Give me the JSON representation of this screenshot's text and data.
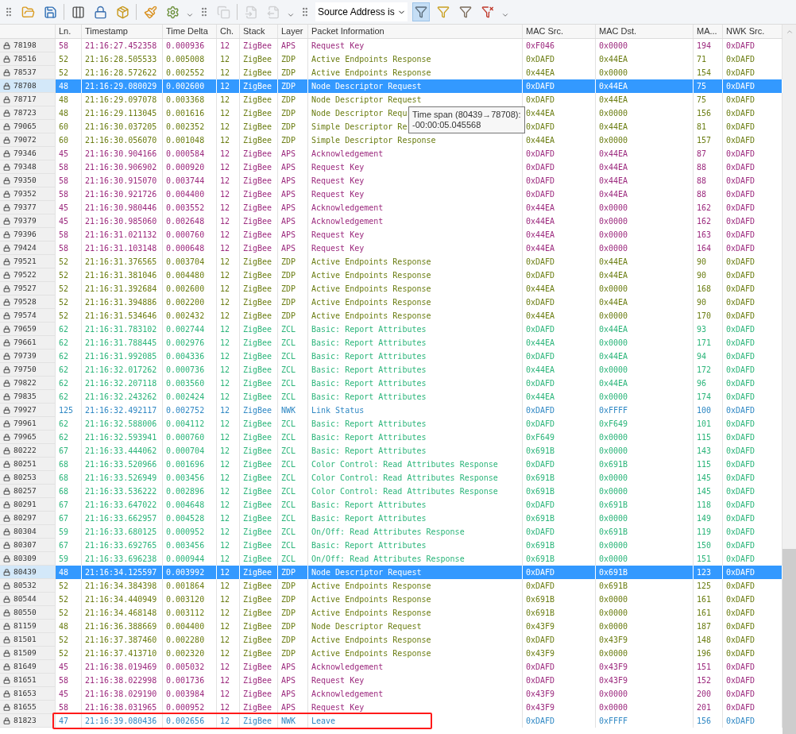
{
  "toolbar": {
    "groups": [
      [
        {
          "kind": "open",
          "disabled": false
        },
        {
          "kind": "save",
          "disabled": false
        },
        {
          "kind": "separator"
        },
        {
          "kind": "columns",
          "disabled": false
        },
        {
          "kind": "lock-list",
          "disabled": false
        },
        {
          "kind": "export",
          "disabled": false
        },
        {
          "kind": "separator"
        },
        {
          "kind": "clean",
          "disabled": false
        },
        {
          "kind": "settings",
          "disabled": false
        }
      ],
      [
        {
          "kind": "copy",
          "disabled": true
        },
        {
          "kind": "separator"
        },
        {
          "kind": "back",
          "disabled": true
        },
        {
          "kind": "forward",
          "disabled": true
        }
      ]
    ],
    "filter": {
      "value": "Source Address is"
    },
    "filter_buttons": [
      {
        "kind": "apply",
        "selected": true
      },
      {
        "kind": "new",
        "selected": false
      },
      {
        "kind": "edit",
        "selected": false
      },
      {
        "kind": "clear",
        "selected": false
      }
    ]
  },
  "table": {
    "columns": [
      "Ln.",
      "Timestamp",
      "Time Delta",
      "Ch.",
      "Stack",
      "Layer",
      "Packet Information",
      "MAC Src.",
      "MAC Dst.",
      "MA...",
      "NWK Src."
    ],
    "rows": [
      {
        "no": "78198",
        "ln": "58",
        "timestamp": "21:16:27.452358",
        "delta": "0.000936",
        "ch": "12",
        "stack": "ZigBee",
        "layer": "APS",
        "info": "Request Key",
        "mac_src": "0xF046",
        "mac_dst": "0x0000",
        "ma": "194",
        "nwk_src": "0xDAFD",
        "color": "#9c2a7e",
        "selected": false,
        "outlined": false
      },
      {
        "no": "78516",
        "ln": "52",
        "timestamp": "21:16:28.505533",
        "delta": "0.005008",
        "ch": "12",
        "stack": "ZigBee",
        "layer": "ZDP",
        "info": "Active Endpoints Response",
        "mac_src": "0xDAFD",
        "mac_dst": "0x44EA",
        "ma": "71",
        "nwk_src": "0xDAFD",
        "color": "#6b7d12",
        "selected": false,
        "outlined": false
      },
      {
        "no": "78537",
        "ln": "52",
        "timestamp": "21:16:28.572622",
        "delta": "0.002552",
        "ch": "12",
        "stack": "ZigBee",
        "layer": "ZDP",
        "info": "Active Endpoints Response",
        "mac_src": "0x44EA",
        "mac_dst": "0x0000",
        "ma": "154",
        "nwk_src": "0xDAFD",
        "color": "#6b7d12",
        "selected": false,
        "outlined": false
      },
      {
        "no": "78708",
        "ln": "48",
        "timestamp": "21:16:29.080029",
        "delta": "0.002600",
        "ch": "12",
        "stack": "ZigBee",
        "layer": "ZDP",
        "info": "Node Descriptor Request",
        "mac_src": "0xDAFD",
        "mac_dst": "0x44EA",
        "ma": "75",
        "nwk_src": "0xDAFD",
        "selected": true,
        "outlined": false
      },
      {
        "no": "78717",
        "ln": "48",
        "timestamp": "21:16:29.097078",
        "delta": "0.003368",
        "ch": "12",
        "stack": "ZigBee",
        "layer": "ZDP",
        "info": "Node Descriptor Request",
        "mac_src": "0xDAFD",
        "mac_dst": "0x44EA",
        "ma": "75",
        "nwk_src": "0xDAFD",
        "color": "#6b7d12",
        "selected": false,
        "outlined": false
      },
      {
        "no": "78723",
        "ln": "48",
        "timestamp": "21:16:29.113045",
        "delta": "0.001616",
        "ch": "12",
        "stack": "ZigBee",
        "layer": "ZDP",
        "info": "Node Descriptor Requ",
        "mac_src": "0x44EA",
        "mac_dst": "0x0000",
        "ma": "156",
        "nwk_src": "0xDAFD",
        "color": "#6b7d12",
        "selected": false,
        "outlined": false
      },
      {
        "no": "79065",
        "ln": "60",
        "timestamp": "21:16:30.037205",
        "delta": "0.002352",
        "ch": "12",
        "stack": "ZigBee",
        "layer": "ZDP",
        "info": "Simple Descriptor Re",
        "mac_src": "0xDAFD",
        "mac_dst": "0x44EA",
        "ma": "81",
        "nwk_src": "0xDAFD",
        "color": "#6b7d12",
        "selected": false,
        "outlined": false
      },
      {
        "no": "79072",
        "ln": "60",
        "timestamp": "21:16:30.056070",
        "delta": "0.001048",
        "ch": "12",
        "stack": "ZigBee",
        "layer": "ZDP",
        "info": "Simple Descriptor Response",
        "mac_src": "0x44EA",
        "mac_dst": "0x0000",
        "ma": "157",
        "nwk_src": "0xDAFD",
        "color": "#6b7d12",
        "selected": false,
        "outlined": false
      },
      {
        "no": "79346",
        "ln": "45",
        "timestamp": "21:16:30.904166",
        "delta": "0.000584",
        "ch": "12",
        "stack": "ZigBee",
        "layer": "APS",
        "info": "Acknowledgement",
        "mac_src": "0xDAFD",
        "mac_dst": "0x44EA",
        "ma": "87",
        "nwk_src": "0xDAFD",
        "color": "#9c2a7e",
        "selected": false,
        "outlined": false
      },
      {
        "no": "79348",
        "ln": "58",
        "timestamp": "21:16:30.906902",
        "delta": "0.000920",
        "ch": "12",
        "stack": "ZigBee",
        "layer": "APS",
        "info": "Request Key",
        "mac_src": "0xDAFD",
        "mac_dst": "0x44EA",
        "ma": "88",
        "nwk_src": "0xDAFD",
        "color": "#9c2a7e",
        "selected": false,
        "outlined": false
      },
      {
        "no": "79350",
        "ln": "58",
        "timestamp": "21:16:30.915070",
        "delta": "0.003744",
        "ch": "12",
        "stack": "ZigBee",
        "layer": "APS",
        "info": "Request Key",
        "mac_src": "0xDAFD",
        "mac_dst": "0x44EA",
        "ma": "88",
        "nwk_src": "0xDAFD",
        "color": "#9c2a7e",
        "selected": false,
        "outlined": false
      },
      {
        "no": "79352",
        "ln": "58",
        "timestamp": "21:16:30.921726",
        "delta": "0.004400",
        "ch": "12",
        "stack": "ZigBee",
        "layer": "APS",
        "info": "Request Key",
        "mac_src": "0xDAFD",
        "mac_dst": "0x44EA",
        "ma": "88",
        "nwk_src": "0xDAFD",
        "color": "#9c2a7e",
        "selected": false,
        "outlined": false
      },
      {
        "no": "79377",
        "ln": "45",
        "timestamp": "21:16:30.980446",
        "delta": "0.003552",
        "ch": "12",
        "stack": "ZigBee",
        "layer": "APS",
        "info": "Acknowledgement",
        "mac_src": "0x44EA",
        "mac_dst": "0x0000",
        "ma": "162",
        "nwk_src": "0xDAFD",
        "color": "#9c2a7e",
        "selected": false,
        "outlined": false
      },
      {
        "no": "79379",
        "ln": "45",
        "timestamp": "21:16:30.985060",
        "delta": "0.002648",
        "ch": "12",
        "stack": "ZigBee",
        "layer": "APS",
        "info": "Acknowledgement",
        "mac_src": "0x44EA",
        "mac_dst": "0x0000",
        "ma": "162",
        "nwk_src": "0xDAFD",
        "color": "#9c2a7e",
        "selected": false,
        "outlined": false
      },
      {
        "no": "79396",
        "ln": "58",
        "timestamp": "21:16:31.021132",
        "delta": "0.000760",
        "ch": "12",
        "stack": "ZigBee",
        "layer": "APS",
        "info": "Request Key",
        "mac_src": "0x44EA",
        "mac_dst": "0x0000",
        "ma": "163",
        "nwk_src": "0xDAFD",
        "color": "#9c2a7e",
        "selected": false,
        "outlined": false
      },
      {
        "no": "79424",
        "ln": "58",
        "timestamp": "21:16:31.103148",
        "delta": "0.000648",
        "ch": "12",
        "stack": "ZigBee",
        "layer": "APS",
        "info": "Request Key",
        "mac_src": "0x44EA",
        "mac_dst": "0x0000",
        "ma": "164",
        "nwk_src": "0xDAFD",
        "color": "#9c2a7e",
        "selected": false,
        "outlined": false
      },
      {
        "no": "79521",
        "ln": "52",
        "timestamp": "21:16:31.376565",
        "delta": "0.003704",
        "ch": "12",
        "stack": "ZigBee",
        "layer": "ZDP",
        "info": "Active Endpoints Response",
        "mac_src": "0xDAFD",
        "mac_dst": "0x44EA",
        "ma": "90",
        "nwk_src": "0xDAFD",
        "color": "#6b7d12",
        "selected": false,
        "outlined": false
      },
      {
        "no": "79522",
        "ln": "52",
        "timestamp": "21:16:31.381046",
        "delta": "0.004480",
        "ch": "12",
        "stack": "ZigBee",
        "layer": "ZDP",
        "info": "Active Endpoints Response",
        "mac_src": "0xDAFD",
        "mac_dst": "0x44EA",
        "ma": "90",
        "nwk_src": "0xDAFD",
        "color": "#6b7d12",
        "selected": false,
        "outlined": false
      },
      {
        "no": "79527",
        "ln": "52",
        "timestamp": "21:16:31.392684",
        "delta": "0.002600",
        "ch": "12",
        "stack": "ZigBee",
        "layer": "ZDP",
        "info": "Active Endpoints Response",
        "mac_src": "0x44EA",
        "mac_dst": "0x0000",
        "ma": "168",
        "nwk_src": "0xDAFD",
        "color": "#6b7d12",
        "selected": false,
        "outlined": false
      },
      {
        "no": "79528",
        "ln": "52",
        "timestamp": "21:16:31.394886",
        "delta": "0.002200",
        "ch": "12",
        "stack": "ZigBee",
        "layer": "ZDP",
        "info": "Active Endpoints Response",
        "mac_src": "0xDAFD",
        "mac_dst": "0x44EA",
        "ma": "90",
        "nwk_src": "0xDAFD",
        "color": "#6b7d12",
        "selected": false,
        "outlined": false
      },
      {
        "no": "79574",
        "ln": "52",
        "timestamp": "21:16:31.534646",
        "delta": "0.002432",
        "ch": "12",
        "stack": "ZigBee",
        "layer": "ZDP",
        "info": "Active Endpoints Response",
        "mac_src": "0x44EA",
        "mac_dst": "0x0000",
        "ma": "170",
        "nwk_src": "0xDAFD",
        "color": "#6b7d12",
        "selected": false,
        "outlined": false
      },
      {
        "no": "79659",
        "ln": "62",
        "timestamp": "21:16:31.783102",
        "delta": "0.002744",
        "ch": "12",
        "stack": "ZigBee",
        "layer": "ZCL",
        "info": "Basic: Report Attributes",
        "mac_src": "0xDAFD",
        "mac_dst": "0x44EA",
        "ma": "93",
        "nwk_src": "0xDAFD",
        "color": "#2bb57a",
        "selected": false,
        "outlined": false
      },
      {
        "no": "79661",
        "ln": "62",
        "timestamp": "21:16:31.788445",
        "delta": "0.002976",
        "ch": "12",
        "stack": "ZigBee",
        "layer": "ZCL",
        "info": "Basic: Report Attributes",
        "mac_src": "0x44EA",
        "mac_dst": "0x0000",
        "ma": "171",
        "nwk_src": "0xDAFD",
        "color": "#2bb57a",
        "selected": false,
        "outlined": false
      },
      {
        "no": "79739",
        "ln": "62",
        "timestamp": "21:16:31.992085",
        "delta": "0.004336",
        "ch": "12",
        "stack": "ZigBee",
        "layer": "ZCL",
        "info": "Basic: Report Attributes",
        "mac_src": "0xDAFD",
        "mac_dst": "0x44EA",
        "ma": "94",
        "nwk_src": "0xDAFD",
        "color": "#2bb57a",
        "selected": false,
        "outlined": false
      },
      {
        "no": "79750",
        "ln": "62",
        "timestamp": "21:16:32.017262",
        "delta": "0.000736",
        "ch": "12",
        "stack": "ZigBee",
        "layer": "ZCL",
        "info": "Basic: Report Attributes",
        "mac_src": "0x44EA",
        "mac_dst": "0x0000",
        "ma": "172",
        "nwk_src": "0xDAFD",
        "color": "#2bb57a",
        "selected": false,
        "outlined": false
      },
      {
        "no": "79822",
        "ln": "62",
        "timestamp": "21:16:32.207118",
        "delta": "0.003560",
        "ch": "12",
        "stack": "ZigBee",
        "layer": "ZCL",
        "info": "Basic: Report Attributes",
        "mac_src": "0xDAFD",
        "mac_dst": "0x44EA",
        "ma": "96",
        "nwk_src": "0xDAFD",
        "color": "#2bb57a",
        "selected": false,
        "outlined": false
      },
      {
        "no": "79835",
        "ln": "62",
        "timestamp": "21:16:32.243262",
        "delta": "0.002424",
        "ch": "12",
        "stack": "ZigBee",
        "layer": "ZCL",
        "info": "Basic: Report Attributes",
        "mac_src": "0x44EA",
        "mac_dst": "0x0000",
        "ma": "174",
        "nwk_src": "0xDAFD",
        "color": "#2bb57a",
        "selected": false,
        "outlined": false
      },
      {
        "no": "79927",
        "ln": "125",
        "timestamp": "21:16:32.492117",
        "delta": "0.002752",
        "ch": "12",
        "stack": "ZigBee",
        "layer": "NWK",
        "info": "Link Status",
        "mac_src": "0xDAFD",
        "mac_dst": "0xFFFF",
        "ma": "100",
        "nwk_src": "0xDAFD",
        "color": "#2f88c4",
        "selected": false,
        "outlined": false
      },
      {
        "no": "79961",
        "ln": "62",
        "timestamp": "21:16:32.588006",
        "delta": "0.004112",
        "ch": "12",
        "stack": "ZigBee",
        "layer": "ZCL",
        "info": "Basic: Report Attributes",
        "mac_src": "0xDAFD",
        "mac_dst": "0xF649",
        "ma": "101",
        "nwk_src": "0xDAFD",
        "color": "#2bb57a",
        "selected": false,
        "outlined": false
      },
      {
        "no": "79965",
        "ln": "62",
        "timestamp": "21:16:32.593941",
        "delta": "0.000760",
        "ch": "12",
        "stack": "ZigBee",
        "layer": "ZCL",
        "info": "Basic: Report Attributes",
        "mac_src": "0xF649",
        "mac_dst": "0x0000",
        "ma": "115",
        "nwk_src": "0xDAFD",
        "color": "#2bb57a",
        "selected": false,
        "outlined": false
      },
      {
        "no": "80222",
        "ln": "67",
        "timestamp": "21:16:33.444062",
        "delta": "0.000704",
        "ch": "12",
        "stack": "ZigBee",
        "layer": "ZCL",
        "info": "Basic: Report Attributes",
        "mac_src": "0x691B",
        "mac_dst": "0x0000",
        "ma": "143",
        "nwk_src": "0xDAFD",
        "color": "#2bb57a",
        "selected": false,
        "outlined": false
      },
      {
        "no": "80251",
        "ln": "68",
        "timestamp": "21:16:33.520966",
        "delta": "0.001696",
        "ch": "12",
        "stack": "ZigBee",
        "layer": "ZCL",
        "info": "Color Control: Read Attributes Response",
        "mac_src": "0xDAFD",
        "mac_dst": "0x691B",
        "ma": "115",
        "nwk_src": "0xDAFD",
        "color": "#2bb57a",
        "selected": false,
        "outlined": false
      },
      {
        "no": "80253",
        "ln": "68",
        "timestamp": "21:16:33.526949",
        "delta": "0.003456",
        "ch": "12",
        "stack": "ZigBee",
        "layer": "ZCL",
        "info": "Color Control: Read Attributes Response",
        "mac_src": "0x691B",
        "mac_dst": "0x0000",
        "ma": "145",
        "nwk_src": "0xDAFD",
        "color": "#2bb57a",
        "selected": false,
        "outlined": false
      },
      {
        "no": "80257",
        "ln": "68",
        "timestamp": "21:16:33.536222",
        "delta": "0.002896",
        "ch": "12",
        "stack": "ZigBee",
        "layer": "ZCL",
        "info": "Color Control: Read Attributes Response",
        "mac_src": "0x691B",
        "mac_dst": "0x0000",
        "ma": "145",
        "nwk_src": "0xDAFD",
        "color": "#2bb57a",
        "selected": false,
        "outlined": false
      },
      {
        "no": "80291",
        "ln": "67",
        "timestamp": "21:16:33.647022",
        "delta": "0.004648",
        "ch": "12",
        "stack": "ZigBee",
        "layer": "ZCL",
        "info": "Basic: Report Attributes",
        "mac_src": "0xDAFD",
        "mac_dst": "0x691B",
        "ma": "118",
        "nwk_src": "0xDAFD",
        "color": "#2bb57a",
        "selected": false,
        "outlined": false
      },
      {
        "no": "80297",
        "ln": "67",
        "timestamp": "21:16:33.662957",
        "delta": "0.004528",
        "ch": "12",
        "stack": "ZigBee",
        "layer": "ZCL",
        "info": "Basic: Report Attributes",
        "mac_src": "0x691B",
        "mac_dst": "0x0000",
        "ma": "149",
        "nwk_src": "0xDAFD",
        "color": "#2bb57a",
        "selected": false,
        "outlined": false
      },
      {
        "no": "80304",
        "ln": "59",
        "timestamp": "21:16:33.680125",
        "delta": "0.000952",
        "ch": "12",
        "stack": "ZigBee",
        "layer": "ZCL",
        "info": "On/Off: Read Attributes Response",
        "mac_src": "0xDAFD",
        "mac_dst": "0x691B",
        "ma": "119",
        "nwk_src": "0xDAFD",
        "color": "#2bb57a",
        "selected": false,
        "outlined": false
      },
      {
        "no": "80307",
        "ln": "67",
        "timestamp": "21:16:33.692765",
        "delta": "0.003456",
        "ch": "12",
        "stack": "ZigBee",
        "layer": "ZCL",
        "info": "Basic: Report Attributes",
        "mac_src": "0x691B",
        "mac_dst": "0x0000",
        "ma": "150",
        "nwk_src": "0xDAFD",
        "color": "#2bb57a",
        "selected": false,
        "outlined": false
      },
      {
        "no": "80309",
        "ln": "59",
        "timestamp": "21:16:33.696238",
        "delta": "0.000944",
        "ch": "12",
        "stack": "ZigBee",
        "layer": "ZCL",
        "info": "On/Off: Read Attributes Response",
        "mac_src": "0x691B",
        "mac_dst": "0x0000",
        "ma": "151",
        "nwk_src": "0xDAFD",
        "color": "#2bb57a",
        "selected": false,
        "outlined": false
      },
      {
        "no": "80439",
        "ln": "48",
        "timestamp": "21:16:34.125597",
        "delta": "0.003992",
        "ch": "12",
        "stack": "ZigBee",
        "layer": "ZDP",
        "info": "Node Descriptor Request",
        "mac_src": "0xDAFD",
        "mac_dst": "0x691B",
        "ma": "123",
        "nwk_src": "0xDAFD",
        "selected": true,
        "outlined": false
      },
      {
        "no": "80532",
        "ln": "52",
        "timestamp": "21:16:34.384398",
        "delta": "0.001864",
        "ch": "12",
        "stack": "ZigBee",
        "layer": "ZDP",
        "info": "Active Endpoints Response",
        "mac_src": "0xDAFD",
        "mac_dst": "0x691B",
        "ma": "125",
        "nwk_src": "0xDAFD",
        "color": "#6b7d12",
        "selected": false,
        "outlined": false
      },
      {
        "no": "80544",
        "ln": "52",
        "timestamp": "21:16:34.440949",
        "delta": "0.003120",
        "ch": "12",
        "stack": "ZigBee",
        "layer": "ZDP",
        "info": "Active Endpoints Response",
        "mac_src": "0x691B",
        "mac_dst": "0x0000",
        "ma": "161",
        "nwk_src": "0xDAFD",
        "color": "#6b7d12",
        "selected": false,
        "outlined": false
      },
      {
        "no": "80550",
        "ln": "52",
        "timestamp": "21:16:34.468148",
        "delta": "0.003112",
        "ch": "12",
        "stack": "ZigBee",
        "layer": "ZDP",
        "info": "Active Endpoints Response",
        "mac_src": "0x691B",
        "mac_dst": "0x0000",
        "ma": "161",
        "nwk_src": "0xDAFD",
        "color": "#6b7d12",
        "selected": false,
        "outlined": false
      },
      {
        "no": "81159",
        "ln": "48",
        "timestamp": "21:16:36.388669",
        "delta": "0.004400",
        "ch": "12",
        "stack": "ZigBee",
        "layer": "ZDP",
        "info": "Node Descriptor Request",
        "mac_src": "0x43F9",
        "mac_dst": "0x0000",
        "ma": "187",
        "nwk_src": "0xDAFD",
        "color": "#6b7d12",
        "selected": false,
        "outlined": false
      },
      {
        "no": "81501",
        "ln": "52",
        "timestamp": "21:16:37.387460",
        "delta": "0.002280",
        "ch": "12",
        "stack": "ZigBee",
        "layer": "ZDP",
        "info": "Active Endpoints Response",
        "mac_src": "0xDAFD",
        "mac_dst": "0x43F9",
        "ma": "148",
        "nwk_src": "0xDAFD",
        "color": "#6b7d12",
        "selected": false,
        "outlined": false
      },
      {
        "no": "81509",
        "ln": "52",
        "timestamp": "21:16:37.413710",
        "delta": "0.002320",
        "ch": "12",
        "stack": "ZigBee",
        "layer": "ZDP",
        "info": "Active Endpoints Response",
        "mac_src": "0x43F9",
        "mac_dst": "0x0000",
        "ma": "196",
        "nwk_src": "0xDAFD",
        "color": "#6b7d12",
        "selected": false,
        "outlined": false
      },
      {
        "no": "81649",
        "ln": "45",
        "timestamp": "21:16:38.019469",
        "delta": "0.005032",
        "ch": "12",
        "stack": "ZigBee",
        "layer": "APS",
        "info": "Acknowledgement",
        "mac_src": "0xDAFD",
        "mac_dst": "0x43F9",
        "ma": "151",
        "nwk_src": "0xDAFD",
        "color": "#9c2a7e",
        "selected": false,
        "outlined": false
      },
      {
        "no": "81651",
        "ln": "58",
        "timestamp": "21:16:38.022998",
        "delta": "0.001736",
        "ch": "12",
        "stack": "ZigBee",
        "layer": "APS",
        "info": "Request Key",
        "mac_src": "0xDAFD",
        "mac_dst": "0x43F9",
        "ma": "152",
        "nwk_src": "0xDAFD",
        "color": "#9c2a7e",
        "selected": false,
        "outlined": false
      },
      {
        "no": "81653",
        "ln": "45",
        "timestamp": "21:16:38.029190",
        "delta": "0.003984",
        "ch": "12",
        "stack": "ZigBee",
        "layer": "APS",
        "info": "Acknowledgement",
        "mac_src": "0x43F9",
        "mac_dst": "0x0000",
        "ma": "200",
        "nwk_src": "0xDAFD",
        "color": "#9c2a7e",
        "selected": false,
        "outlined": false
      },
      {
        "no": "81655",
        "ln": "58",
        "timestamp": "21:16:38.031965",
        "delta": "0.000952",
        "ch": "12",
        "stack": "ZigBee",
        "layer": "APS",
        "info": "Request Key",
        "mac_src": "0x43F9",
        "mac_dst": "0x0000",
        "ma": "201",
        "nwk_src": "0xDAFD",
        "color": "#9c2a7e",
        "selected": false,
        "outlined": false
      },
      {
        "no": "81823",
        "ln": "47",
        "timestamp": "21:16:39.080436",
        "delta": "0.002656",
        "ch": "12",
        "stack": "ZigBee",
        "layer": "NWK",
        "info": "Leave",
        "mac_src": "0xDAFD",
        "mac_dst": "0xFFFF",
        "ma": "156",
        "nwk_src": "0xDAFD",
        "color": "#2f88c4",
        "selected": false,
        "outlined": true
      }
    ]
  },
  "tooltip": {
    "lines": [
      "Time span (80439→78708):",
      "-00:00:05.045568"
    ]
  }
}
